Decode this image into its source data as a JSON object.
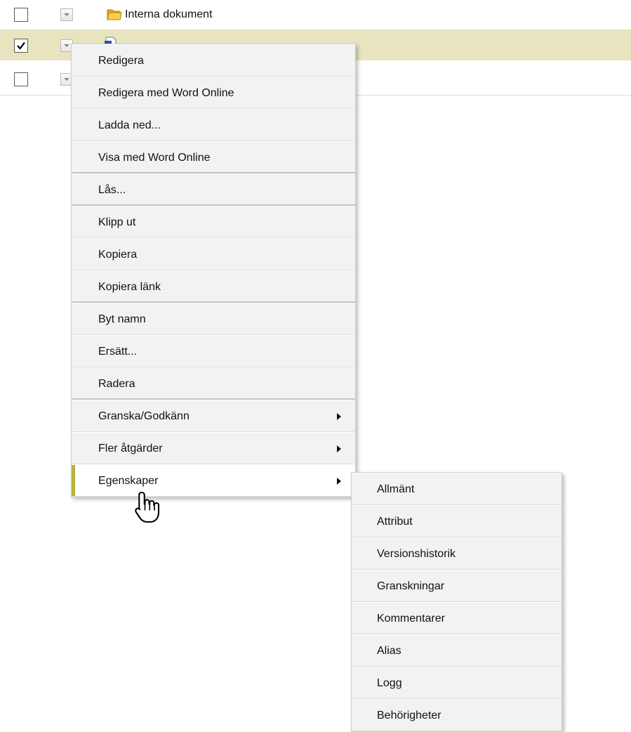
{
  "file_list": {
    "rows": [
      {
        "name": "Interna dokument",
        "checked": false,
        "icon": "folder-icon"
      },
      {
        "name": "",
        "checked": true,
        "icon": "word-document-icon"
      },
      {
        "name": "",
        "checked": false,
        "icon": ""
      }
    ]
  },
  "context_menu": {
    "items": [
      {
        "label": "Redigera"
      },
      {
        "label": "Redigera med Word Online"
      },
      {
        "label": "Ladda ned..."
      },
      {
        "label": "Visa med Word Online"
      },
      {
        "label": "Lås..."
      },
      {
        "label": "Klipp ut"
      },
      {
        "label": "Kopiera"
      },
      {
        "label": "Kopiera länk"
      },
      {
        "label": "Byt namn"
      },
      {
        "label": "Ersätt..."
      },
      {
        "label": "Radera"
      },
      {
        "label": "Granska/Godkänn",
        "has_submenu": true
      },
      {
        "label": "Fler åtgärder",
        "has_submenu": true
      },
      {
        "label": "Egenskaper",
        "has_submenu": true,
        "active": true
      }
    ]
  },
  "properties_submenu": {
    "items": [
      {
        "label": "Allmänt"
      },
      {
        "label": "Attribut"
      },
      {
        "label": "Versionshistorik"
      },
      {
        "label": "Granskningar"
      },
      {
        "label": "Kommentarer"
      },
      {
        "label": "Alias"
      },
      {
        "label": "Logg"
      },
      {
        "label": "Behörigheter"
      }
    ]
  },
  "colors": {
    "selected_row": "#e8e4c0",
    "menu_background": "#f2f2f2",
    "active_accent": "#b9b23a",
    "folder": "#f2c43a"
  },
  "cursor": "hand-pointer-icon"
}
